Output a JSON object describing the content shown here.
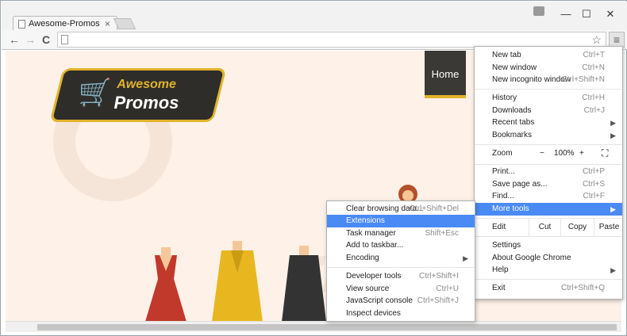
{
  "window": {
    "tab_title": "Awesome-Promos",
    "tab_close": "×",
    "minimize": "—",
    "maximize": "☐",
    "close": "✕"
  },
  "toolbar": {
    "back": "←",
    "forward": "→",
    "reload": "C",
    "star": "☆",
    "menu": "≡"
  },
  "page": {
    "logo_line1": "Awesome",
    "logo_line2": "Promos",
    "nav_home": "Home"
  },
  "main_menu": {
    "items": [
      {
        "label": "New tab",
        "shortcut": "Ctrl+T"
      },
      {
        "label": "New window",
        "shortcut": "Ctrl+N"
      },
      {
        "label": "New incognito window",
        "shortcut": "Ctrl+Shift+N"
      },
      {
        "label": "History",
        "shortcut": "Ctrl+H"
      },
      {
        "label": "Downloads",
        "shortcut": "Ctrl+J"
      },
      {
        "label": "Recent tabs",
        "shortcut": ""
      },
      {
        "label": "Bookmarks",
        "shortcut": ""
      },
      {
        "label": "Print...",
        "shortcut": "Ctrl+P"
      },
      {
        "label": "Save page as...",
        "shortcut": "Ctrl+S"
      },
      {
        "label": "Find...",
        "shortcut": "Ctrl+F"
      },
      {
        "label": "More tools",
        "shortcut": ""
      },
      {
        "label": "Settings",
        "shortcut": ""
      },
      {
        "label": "About Google Chrome",
        "shortcut": ""
      },
      {
        "label": "Help",
        "shortcut": ""
      },
      {
        "label": "Exit",
        "shortcut": "Ctrl+Shift+Q"
      }
    ],
    "zoom": {
      "label": "Zoom",
      "minus": "−",
      "value": "100%",
      "plus": "+",
      "fullscreen": "⛶"
    },
    "edit": {
      "label": "Edit",
      "cut": "Cut",
      "copy": "Copy",
      "paste": "Paste"
    }
  },
  "sub_menu": {
    "items": [
      {
        "label": "Clear browsing data...",
        "shortcut": "Ctrl+Shift+Del"
      },
      {
        "label": "Extensions",
        "shortcut": ""
      },
      {
        "label": "Task manager",
        "shortcut": "Shift+Esc"
      },
      {
        "label": "Add to taskbar...",
        "shortcut": ""
      },
      {
        "label": "Encoding",
        "shortcut": ""
      },
      {
        "label": "Developer tools",
        "shortcut": "Ctrl+Shift+I"
      },
      {
        "label": "View source",
        "shortcut": "Ctrl+U"
      },
      {
        "label": "JavaScript console",
        "shortcut": "Ctrl+Shift+J"
      },
      {
        "label": "Inspect devices",
        "shortcut": ""
      }
    ]
  },
  "colors": {
    "highlight": "#4a8af4",
    "brand_gold": "#e0b32b",
    "page_bg": "#fdf1e8"
  }
}
